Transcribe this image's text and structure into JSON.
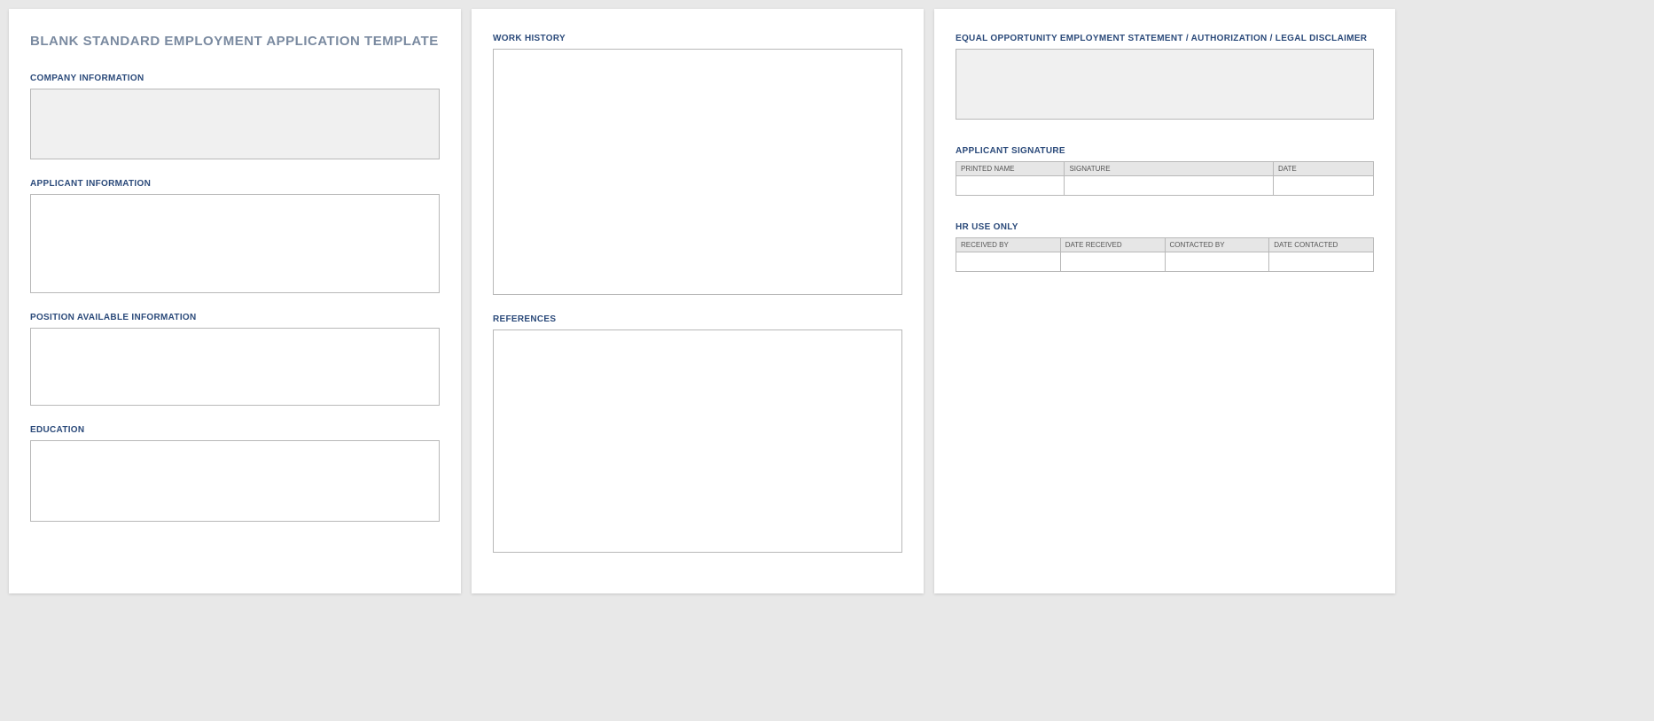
{
  "page1": {
    "title": "BLANK STANDARD EMPLOYMENT APPLICATION TEMPLATE",
    "company_label": "COMPANY INFORMATION",
    "applicant_label": "APPLICANT INFORMATION",
    "position_label": "POSITION AVAILABLE INFORMATION",
    "education_label": "EDUCATION"
  },
  "page2": {
    "work_history_label": "WORK HISTORY",
    "references_label": "REFERENCES"
  },
  "page3": {
    "eeo_label": "EQUAL OPPORTUNITY EMPLOYMENT STATEMENT / AUTHORIZATION / LEGAL DISCLAIMER",
    "signature_label": "APPLICANT SIGNATURE",
    "sig_headers": {
      "printed": "PRINTED NAME",
      "signature": "SIGNATURE",
      "date": "DATE"
    },
    "hr_label": "HR USE ONLY",
    "hr_headers": {
      "received_by": "RECEIVED BY",
      "date_received": "DATE RECEIVED",
      "contacted_by": "CONTACTED BY",
      "date_contacted": "DATE CONTACTED"
    }
  }
}
